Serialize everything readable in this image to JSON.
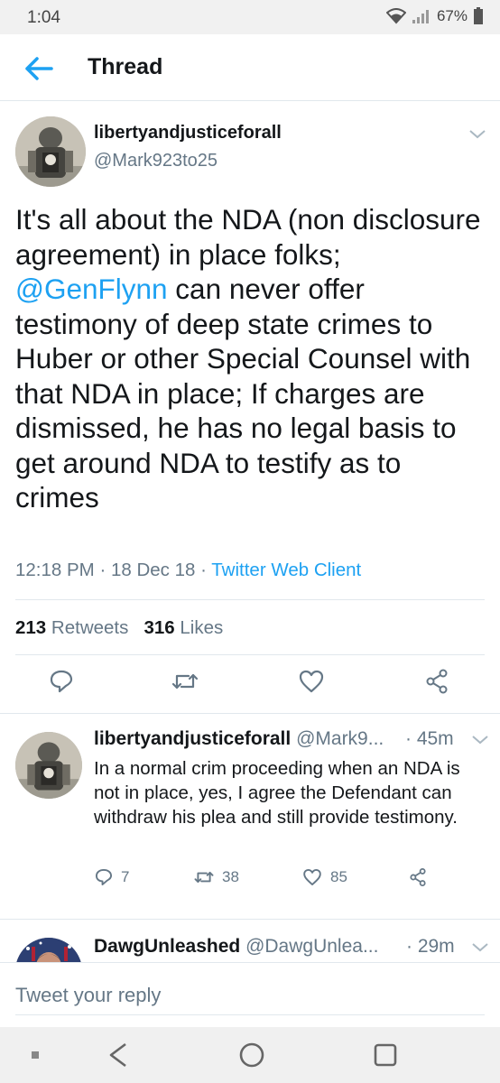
{
  "status_bar": {
    "time": "1:04",
    "battery": "67%"
  },
  "header": {
    "title": "Thread"
  },
  "main_tweet": {
    "name": "libertyandjusticeforall",
    "handle": "@Mark923to25",
    "text_part1": "It's all about the NDA (non disclosure agreement) in place folks; ",
    "mention": "@GenFlynn",
    "text_part2": " can never offer testimony of deep state crimes to Huber or other Special Counsel with that NDA in place; If charges are dismissed, he has no legal basis to get around NDA to testify as to crimes",
    "time": "12:18 PM",
    "date": "18 Dec 18",
    "client": "Twitter Web Client",
    "retweet_count": "213",
    "retweets_label": "Retweets",
    "like_count": "316",
    "likes_label": "Likes"
  },
  "replies": [
    {
      "name": "libertyandjusticeforall",
      "handle": "@Mark9...",
      "time": "45m",
      "text": "In a normal crim proceeding when an NDA is not in place, yes, I agree the Defendant can withdraw his plea and still provide testimony.",
      "reply_count": "7",
      "retweet_count": "38",
      "like_count": "85"
    },
    {
      "name": "DawgUnleashed",
      "handle": "@DawgUnlea...",
      "time": "29m"
    }
  ],
  "compose": {
    "placeholder": "Tweet your reply"
  },
  "colors": {
    "accent": "#1da1f2",
    "muted": "#657786",
    "text": "#14171a",
    "border": "#e1e8ed"
  },
  "icons": [
    "wifi-icon",
    "signal-icon",
    "battery-icon",
    "back-arrow-icon",
    "chevron-down-icon",
    "reply-icon",
    "retweet-icon",
    "like-icon",
    "share-icon",
    "nav-back-icon",
    "nav-home-icon",
    "nav-recents-icon"
  ]
}
